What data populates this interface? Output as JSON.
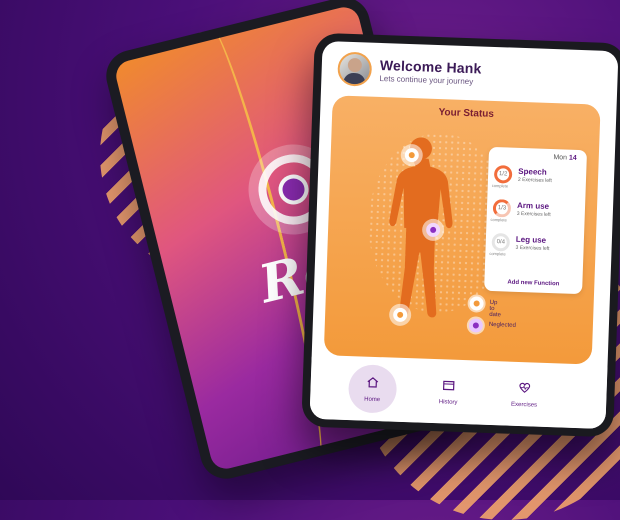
{
  "background": {
    "accent": "#4a0f78",
    "stripe_color": "#f2a46b"
  },
  "splash": {
    "word": "Rev"
  },
  "header": {
    "welcome": "Welcome Hank",
    "subtitle": "Lets continue your journey"
  },
  "status": {
    "title": "Your Status",
    "date_day": "Mon",
    "date_num": "14",
    "functions": [
      {
        "name": "Speech",
        "left": "2 Exercises left",
        "progress": "1/2",
        "complete_label": "complete"
      },
      {
        "name": "Arm use",
        "left": "3 Exercises left",
        "progress": "1/3",
        "complete_label": "complete"
      },
      {
        "name": "Leg use",
        "left": "3 Exercises left",
        "progress": "0/4",
        "complete_label": "complete"
      }
    ],
    "add_function": "Add new Function",
    "legend": {
      "up_to_date": "Up to date",
      "neglected": "Neglected"
    }
  },
  "nav": {
    "home": "Home",
    "history": "History",
    "exercises": "Exercises"
  },
  "colors": {
    "primary": "#5b1680",
    "orange": "#f39a3b",
    "neglect": "#8b2fc2"
  }
}
